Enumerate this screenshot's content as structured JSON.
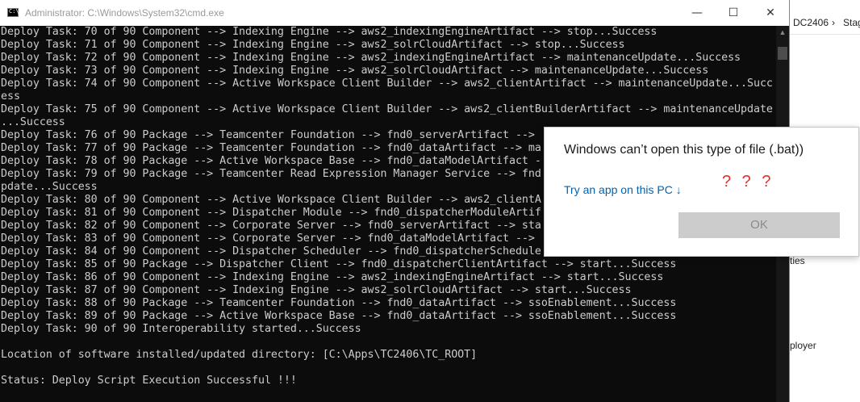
{
  "explorer": {
    "address_segments": [
      "DC2406",
      "›",
      "Stag"
    ],
    "side_items": [
      "ties",
      "ployer"
    ]
  },
  "cmd": {
    "title": "Administrator: C:\\Windows\\System32\\cmd.exe",
    "icon": "cmd-icon",
    "buttons": {
      "minimize": "—",
      "maximize": "☐",
      "close": "✕"
    },
    "lines": [
      "Deploy Task: 70 of 90 Component --> Indexing Engine --> aws2_indexingEngineArtifact --> stop...Success",
      "Deploy Task: 71 of 90 Component --> Indexing Engine --> aws2_solrCloudArtifact --> stop...Success",
      "Deploy Task: 72 of 90 Component --> Indexing Engine --> aws2_indexingEngineArtifact --> maintenanceUpdate...Success",
      "Deploy Task: 73 of 90 Component --> Indexing Engine --> aws2_solrCloudArtifact --> maintenanceUpdate...Success",
      "Deploy Task: 74 of 90 Component --> Active Workspace Client Builder --> aws2_clientArtifact --> maintenanceUpdate...Succ",
      "ess",
      "Deploy Task: 75 of 90 Component --> Active Workspace Client Builder --> aws2_clientBuilderArtifact --> maintenanceUpdate",
      "...Success",
      "Deploy Task: 76 of 90 Package --> Teamcenter Foundation --> fnd0_serverArtifact -->",
      "Deploy Task: 77 of 90 Package --> Teamcenter Foundation --> fnd0_dataArtifact --> ma",
      "Deploy Task: 78 of 90 Package --> Active Workspace Base --> fnd0_dataModelArtifact -",
      "Deploy Task: 79 of 90 Package --> Teamcenter Read Expression Manager Service --> fnd",
      "pdate...Success",
      "Deploy Task: 80 of 90 Component --> Active Workspace Client Builder --> aws2_clientA",
      "Deploy Task: 81 of 90 Component --> Dispatcher Module --> fnd0_dispatcherModuleArtif",
      "Deploy Task: 82 of 90 Component --> Corporate Server --> fnd0_serverArtifact --> sta",
      "Deploy Task: 83 of 90 Component --> Corporate Server --> fnd0_dataModelArtifact -->",
      "Deploy Task: 84 of 90 Component --> Dispatcher Scheduler --> fnd0_dispatcherSchedule",
      "Deploy Task: 85 of 90 Package --> Dispatcher Client --> fnd0_dispatcherClientArtifact --> start...Success",
      "Deploy Task: 86 of 90 Component --> Indexing Engine --> aws2_indexingEngineArtifact --> start...Success",
      "Deploy Task: 87 of 90 Component --> Indexing Engine --> aws2_solrCloudArtifact --> start...Success",
      "Deploy Task: 88 of 90 Package --> Teamcenter Foundation --> fnd0_dataArtifact --> ssoEnablement...Success",
      "Deploy Task: 89 of 90 Package --> Active Workspace Base --> fnd0_dataArtifact --> ssoEnablement...Success",
      "Deploy Task: 90 of 90 Interoperability started...Success",
      "",
      "Location of software installed/updated directory: [C:\\Apps\\TC2406\\TC_ROOT]",
      "",
      "Status: Deploy Script Execution Successful !!!"
    ]
  },
  "dialog": {
    "message": "Windows can’t open this type of file (.bat))",
    "link_text": "Try an app on this PC ↓",
    "annotation": "? ? ?",
    "ok_label": "OK"
  },
  "colors": {
    "console_bg": "#0c0c0c",
    "console_text": "#cccccc",
    "link": "#0063b1",
    "annotation": "#e03030",
    "accent": "#0078d7"
  }
}
